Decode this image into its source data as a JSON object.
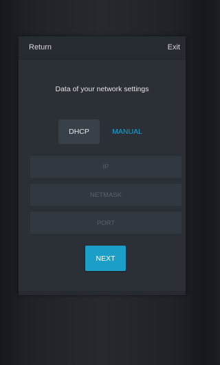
{
  "header": {
    "return_label": "Return",
    "exit_label": "Exit"
  },
  "subtitle": "Data of your network settings",
  "modes": {
    "dhcp_label": "DHCP",
    "manual_label": "MANUAL",
    "selected": "MANUAL"
  },
  "fields": {
    "ip": {
      "value": "",
      "placeholder": "IP"
    },
    "netmask": {
      "value": "",
      "placeholder": "NETMASK"
    },
    "port": {
      "value": "",
      "placeholder": "PORT"
    }
  },
  "next_label": "NEXT",
  "colors": {
    "accent": "#1b9fc7",
    "panel": "#2b3036",
    "background": "#1f2328"
  }
}
